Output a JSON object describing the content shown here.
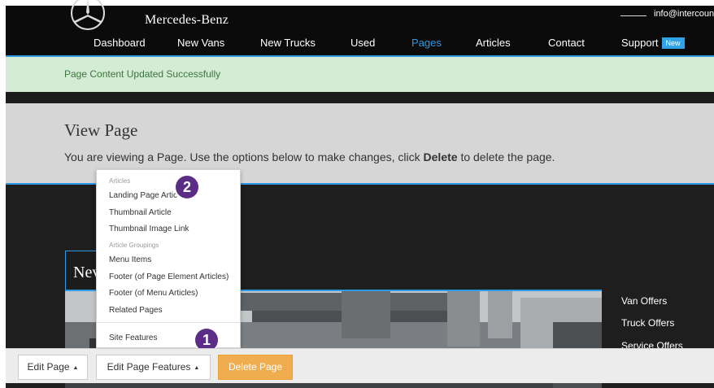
{
  "header": {
    "brand": "Mercedes-Benz",
    "contact_email": "info@intercoun",
    "nav": [
      {
        "label": "Dashboard"
      },
      {
        "label": "New Vans"
      },
      {
        "label": "New Trucks"
      },
      {
        "label": "Used"
      },
      {
        "label": "Pages"
      },
      {
        "label": "Articles"
      },
      {
        "label": "Contact"
      },
      {
        "label": "Support",
        "badge": "New"
      }
    ],
    "active_nav": "Pages"
  },
  "alert": {
    "message": "Page Content Updated Successfully"
  },
  "panel": {
    "title": "View Page",
    "desc_prefix": "You are viewing a Page. Use the options below to make changes, click ",
    "desc_bold": "Delete",
    "desc_suffix": " to delete the page."
  },
  "content": {
    "news_title": "Nev",
    "offers": [
      "Van Offers",
      "Truck Offers",
      "Service Offers"
    ]
  },
  "dropdown": {
    "groups": [
      {
        "header": "Articles",
        "items": [
          "Landing Page Artic",
          "Thumbnail Article",
          "Thumbnail Image Link"
        ]
      },
      {
        "header": "Article Groupings",
        "items": [
          "Menu Items",
          "Footer (of Page Element Articles)",
          "Footer (of Menu Articles)",
          "Related Pages"
        ]
      }
    ],
    "footer_item": "Site Features"
  },
  "markers": [
    "1",
    "2"
  ],
  "toolbar": {
    "edit_page": "Edit Page",
    "edit_features": "Edit Page Features",
    "delete": "Delete Page"
  },
  "colors": {
    "accent": "#2f9ae6",
    "success_bg": "#d4ecd4",
    "warning": "#f0ad4e",
    "marker": "#5b2d86"
  },
  "icons": {
    "logo": "mercedes-star-icon",
    "caret": "caret-up-icon"
  }
}
